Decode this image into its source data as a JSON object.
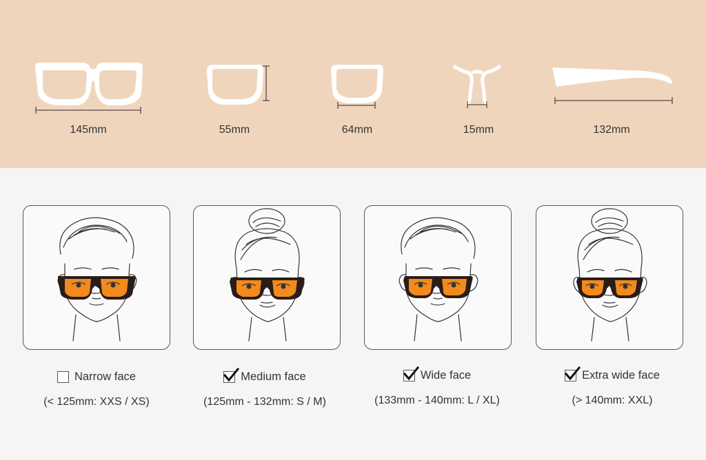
{
  "measurements": [
    {
      "label": "145mm",
      "icon": "frame-width-icon"
    },
    {
      "label": "55mm",
      "icon": "lens-height-icon"
    },
    {
      "label": "64mm",
      "icon": "lens-width-icon"
    },
    {
      "label": "15mm",
      "icon": "bridge-width-icon"
    },
    {
      "label": "132mm",
      "icon": "temple-length-icon"
    }
  ],
  "faces": [
    {
      "title": "Narrow face",
      "range": "(< 125mm: XXS / XS)",
      "checked": false,
      "portrait": "male"
    },
    {
      "title": "Medium face",
      "range": "(125mm - 132mm: S / M)",
      "checked": true,
      "portrait": "female"
    },
    {
      "title": "Wide face",
      "range": "(133mm - 140mm: L / XL)",
      "checked": true,
      "portrait": "male"
    },
    {
      "title": "Extra wide face",
      "range": "(> 140mm: XXL)",
      "checked": true,
      "portrait": "female"
    }
  ],
  "colors": {
    "band": "#f0d5bd",
    "lens": "#f28a1e",
    "frame": "#2a1d18",
    "dimension_line": "#5a4848"
  }
}
